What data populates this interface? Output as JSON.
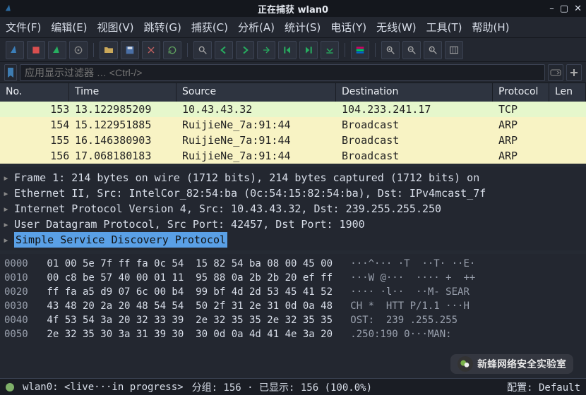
{
  "window": {
    "title": "正在捕获 wlan0"
  },
  "menu": {
    "items": [
      "文件(F)",
      "编辑(E)",
      "视图(V)",
      "跳转(G)",
      "捕获(C)",
      "分析(A)",
      "统计(S)",
      "电话(Y)",
      "无线(W)",
      "工具(T)",
      "帮助(H)"
    ]
  },
  "filter": {
    "placeholder": "应用显示过滤器 … <Ctrl-/>"
  },
  "columns": {
    "no": "No.",
    "time": "Time",
    "source": "Source",
    "dest": "Destination",
    "proto": "Protocol",
    "len": "Len"
  },
  "packets": [
    {
      "no": "153",
      "time": "13.122985209",
      "source": "10.43.43.32",
      "dest": "104.233.241.17",
      "proto": "TCP",
      "style": "light"
    },
    {
      "no": "154",
      "time": "15.122951885",
      "source": "RuijieNe_7a:91:44",
      "dest": "Broadcast",
      "proto": "ARP",
      "style": "cream"
    },
    {
      "no": "155",
      "time": "16.146380903",
      "source": "RuijieNe_7a:91:44",
      "dest": "Broadcast",
      "proto": "ARP",
      "style": "cream"
    },
    {
      "no": "156",
      "time": "17.068180183",
      "source": "RuijieNe_7a:91:44",
      "dest": "Broadcast",
      "proto": "ARP",
      "style": "cream"
    }
  ],
  "details": [
    "Frame 1: 214 bytes on wire (1712 bits), 214 bytes captured (1712 bits) on ",
    "Ethernet II, Src: IntelCor_82:54:ba (0c:54:15:82:54:ba), Dst: IPv4mcast_7f",
    "Internet Protocol Version 4, Src: 10.43.43.32, Dst: 239.255.255.250",
    "User Datagram Protocol, Src Port: 42457, Dst Port: 1900",
    "Simple Service Discovery Protocol"
  ],
  "hex": [
    {
      "off": "0000",
      "b": "01 00 5e 7f ff fa 0c 54  15 82 54 ba 08 00 45 00",
      "a": "···^··· ·T  ··T· ··E·"
    },
    {
      "off": "0010",
      "b": "00 c8 be 57 40 00 01 11  95 88 0a 2b 2b 20 ef ff",
      "a": "···W @···  ···· +  ++"
    },
    {
      "off": "0020",
      "b": "ff fa a5 d9 07 6c 00 b4  99 bf 4d 2d 53 45 41 52",
      "a": "···· ·l··  ··M- SEAR"
    },
    {
      "off": "0030",
      "b": "43 48 20 2a 20 48 54 54  50 2f 31 2e 31 0d 0a 48",
      "a": "CH *  HTT P/1.1 ···H"
    },
    {
      "off": "0040",
      "b": "4f 53 54 3a 20 32 33 39  2e 32 35 35 2e 32 35 35",
      "a": "OST:  239 .255.255"
    },
    {
      "off": "0050",
      "b": "2e 32 35 30 3a 31 39 30  30 0d 0a 4d 41 4e 3a 20",
      "a": ".250:190 0···MAN: "
    }
  ],
  "status": {
    "iface": "wlan0: <live···in progress>",
    "packets": "分组: 156 · 已显示: 156 (100.0%)",
    "profile": "配置: Default"
  },
  "watermark": {
    "text": "新蜂网络安全实验室"
  },
  "colors": {
    "light_row_bg": "#e6f7cc",
    "cream_row_bg": "#f8f3c4",
    "selected_detail_bg": "#5aa0e6"
  }
}
